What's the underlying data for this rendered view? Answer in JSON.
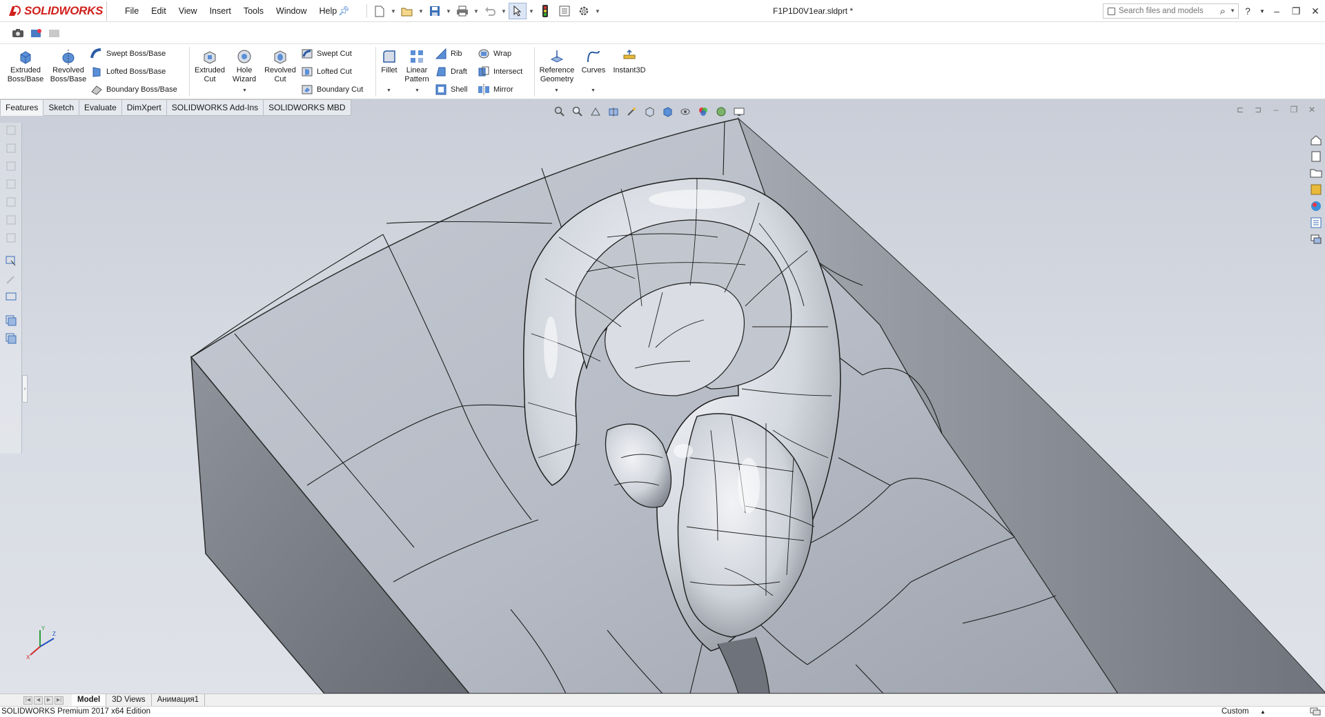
{
  "app": {
    "name": "SOLIDWORKS",
    "document_title": "F1P1D0V1ear.sldprt *"
  },
  "menu": [
    "File",
    "Edit",
    "View",
    "Insert",
    "Tools",
    "Window",
    "Help"
  ],
  "search": {
    "placeholder": "Search files and models"
  },
  "commands": {
    "extruded_boss": "Extruded Boss/Base",
    "revolved_boss": "Revolved Boss/Base",
    "swept_boss": "Swept Boss/Base",
    "lofted_boss": "Lofted Boss/Base",
    "boundary_boss": "Boundary Boss/Base",
    "extruded_cut": "Extruded Cut",
    "hole_wizard": "Hole Wizard",
    "revolved_cut": "Revolved Cut",
    "swept_cut": "Swept Cut",
    "lofted_cut": "Lofted Cut",
    "boundary_cut": "Boundary Cut",
    "fillet": "Fillet",
    "linear_pattern": "Linear Pattern",
    "rib": "Rib",
    "draft": "Draft",
    "shell": "Shell",
    "wrap": "Wrap",
    "intersect": "Intersect",
    "mirror": "Mirror",
    "reference_geometry": "Reference Geometry",
    "curves": "Curves",
    "instant3d": "Instant3D"
  },
  "command_tabs": [
    "Features",
    "Sketch",
    "Evaluate",
    "DimXpert",
    "SOLIDWORKS Add-Ins",
    "SOLIDWORKS MBD"
  ],
  "active_command_tab": "Features",
  "bottom_tabs": [
    "Model",
    "3D Views",
    "Анимация1"
  ],
  "active_bottom_tab": "Model",
  "status": {
    "edition": "SOLIDWORKS Premium 2017 x64 Edition",
    "units": "Custom"
  },
  "colors": {
    "brand_red": "#d0201c",
    "viewport_top": "#c9ced8",
    "viewport_bottom": "#dfe2e8",
    "model_face": "#b4b9c3",
    "model_side": "#7b7f88"
  }
}
